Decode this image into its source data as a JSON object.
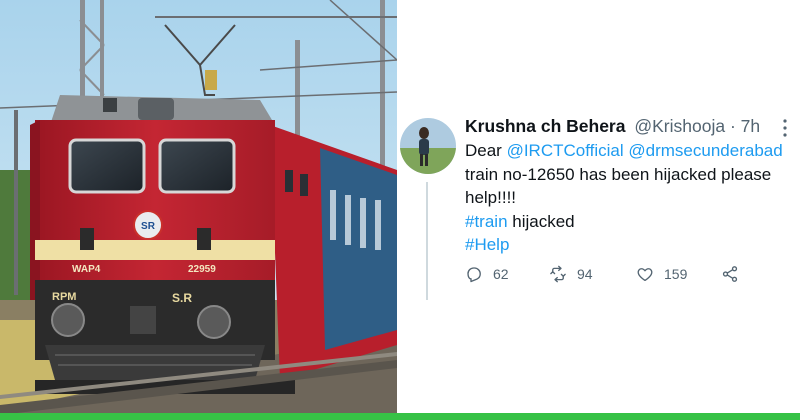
{
  "photo": {
    "loco_class": "WAP4",
    "loco_number": "22959",
    "shed_logo": "SR",
    "rpm_mark": "RPM",
    "sr_mark": "S.R",
    "colors": {
      "body_red": "#b81f2c",
      "stripe_cream": "#efe0a5",
      "sky": "#b9dcef"
    }
  },
  "tweet": {
    "display_name": "Krushna ch Behera",
    "handle": "@Krishooja",
    "separator": "·",
    "time": "7h",
    "text": {
      "line1_prefix": "Dear ",
      "mention1": "@IRCTCofficial",
      "mention2": "@drmsecunderabad",
      "line2": "train no-12650 has been hijacked please",
      "line3": "help!!!!",
      "hashtag1": "#train",
      "line4_suffix": " hijacked",
      "hashtag2": "#Help"
    },
    "actions": {
      "reply_count": "62",
      "retweet_count": "94",
      "like_count": "159"
    },
    "icons": [
      "more-icon",
      "reply-icon",
      "retweet-icon",
      "like-icon",
      "share-icon"
    ],
    "colors": {
      "link": "#1d9bf0",
      "text": "#0f1419",
      "muted": "#536471"
    }
  },
  "frame": {
    "bottom_bar_color": "#37c246"
  }
}
